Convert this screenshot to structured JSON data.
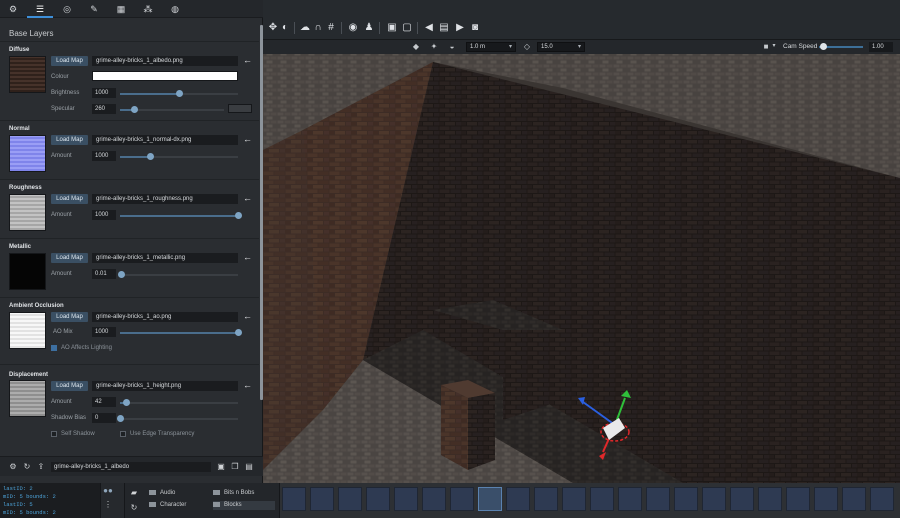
{
  "panel": {
    "tabs": [
      {
        "icon": "gear-icon",
        "glyph": "⚙"
      },
      {
        "icon": "sliders-icon",
        "glyph": "☰"
      },
      {
        "icon": "target-icon",
        "glyph": "◎"
      },
      {
        "icon": "brush-icon",
        "glyph": "✎"
      },
      {
        "icon": "grid-icon",
        "glyph": "▦"
      },
      {
        "icon": "nodes-icon",
        "glyph": "⁂"
      },
      {
        "icon": "globe-icon",
        "glyph": "◍"
      }
    ],
    "active_tab": 1,
    "title": "Base Layers",
    "load_label": "Load Map",
    "diffuse": {
      "title": "Diffuse",
      "file": "grime-alley-bricks_1_albedo.png",
      "colour_label": "Colour",
      "brightness_label": "Brightness",
      "brightness_value": "1000",
      "brightness_fraction": 0.5,
      "specular_label": "Specular",
      "specular_value": "260",
      "specular_fraction": 0.13
    },
    "normal": {
      "title": "Normal",
      "file": "grime-alley-bricks_1_normal-dx.png",
      "amount_label": "Amount",
      "amount_value": "1000",
      "amount_fraction": 0.25
    },
    "roughness": {
      "title": "Roughness",
      "file": "grime-alley-bricks_1_roughness.png",
      "amount_label": "Amount",
      "amount_value": "1000",
      "amount_fraction": 1.0
    },
    "metallic": {
      "title": "Metallic",
      "file": "grime-alley-bricks_1_metallic.png",
      "amount_label": "Amount",
      "amount_value": "0.01",
      "amount_fraction": 0.01
    },
    "ao": {
      "title": "Ambient Occlusion",
      "file": "grime-alley-bricks_1_ao.png",
      "mix_label": "AO Mix",
      "mix_value": "1000",
      "mix_fraction": 1.0,
      "affects_lighting_label": "AO Affects Lighting",
      "affects_lighting_checked": true
    },
    "displacement": {
      "title": "Displacement",
      "file": "grime-alley-bricks_1_height.png",
      "amount_label": "Amount",
      "amount_value": "42",
      "amount_fraction": 0.05,
      "bias_label": "Shadow Bias",
      "bias_value": "0",
      "bias_fraction": 0.0,
      "self_shadow_label": "Self Shadow",
      "edge_label": "Use Edge Transparency"
    },
    "footer": {
      "material_name": "grime-alley-bricks_1_albedo"
    }
  },
  "toolbar": {
    "grid_size": "1.0 m",
    "angle_snap": "15.0",
    "cam_speed_label": "Cam Speed",
    "cam_speed_value": "1.00",
    "cam_speed_fraction": 0.1
  },
  "console": {
    "lines": [
      "lastID: 2",
      "mID: 5   bounds: 2",
      "lastID: 5",
      "mID: 5   bounds: 2",
      "lastID: 5"
    ]
  },
  "folders": {
    "left": [
      "Audio",
      "Character"
    ],
    "right": [
      "Bits n Bobs",
      "Blocks"
    ]
  },
  "colors": {
    "accent": "#3d8fd9",
    "panel_bg": "#2a2d31",
    "gizmo_x": "#e0282a",
    "gizmo_y": "#2fbf3a",
    "gizmo_z": "#2a5fe0"
  }
}
